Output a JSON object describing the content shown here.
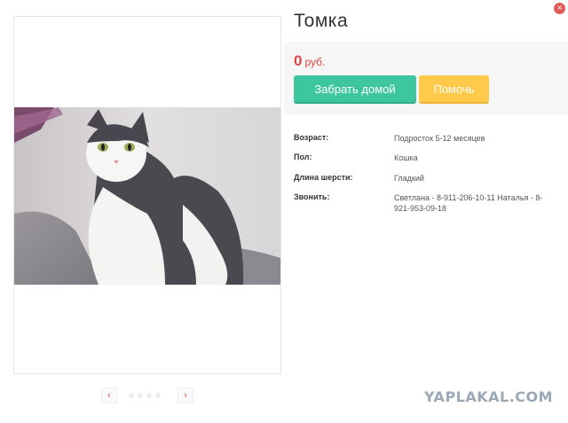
{
  "pet": {
    "name": "Томка",
    "price_value": "0",
    "price_currency": "руб.",
    "photo_alt": "cat photo"
  },
  "actions": {
    "take_home_label": "Забрать домой",
    "help_label": "Помочь",
    "close_label": "×"
  },
  "gallery": {
    "prev_label": "‹",
    "next_label": "›",
    "dot_count": 4
  },
  "details": [
    {
      "label": "Возраст:",
      "value": "Подросток 5-12 месяцев"
    },
    {
      "label": "Пол:",
      "value": "Кошка"
    },
    {
      "label": "Длина шерсти:",
      "value": "Гладкий"
    },
    {
      "label": "Звонить:",
      "value": "Светлана - 8-911-206-10-11 Наталья - 8-921-953-09-18"
    }
  ],
  "watermark": "YAPLAKAL.COM",
  "colors": {
    "accent_green": "#3ec79e",
    "accent_yellow": "#ffc94a",
    "price_red": "#e04545",
    "close_red": "#e25a5a"
  },
  "icons": {
    "close": "close-icon",
    "prev": "chevron-left-icon",
    "next": "chevron-right-icon"
  }
}
